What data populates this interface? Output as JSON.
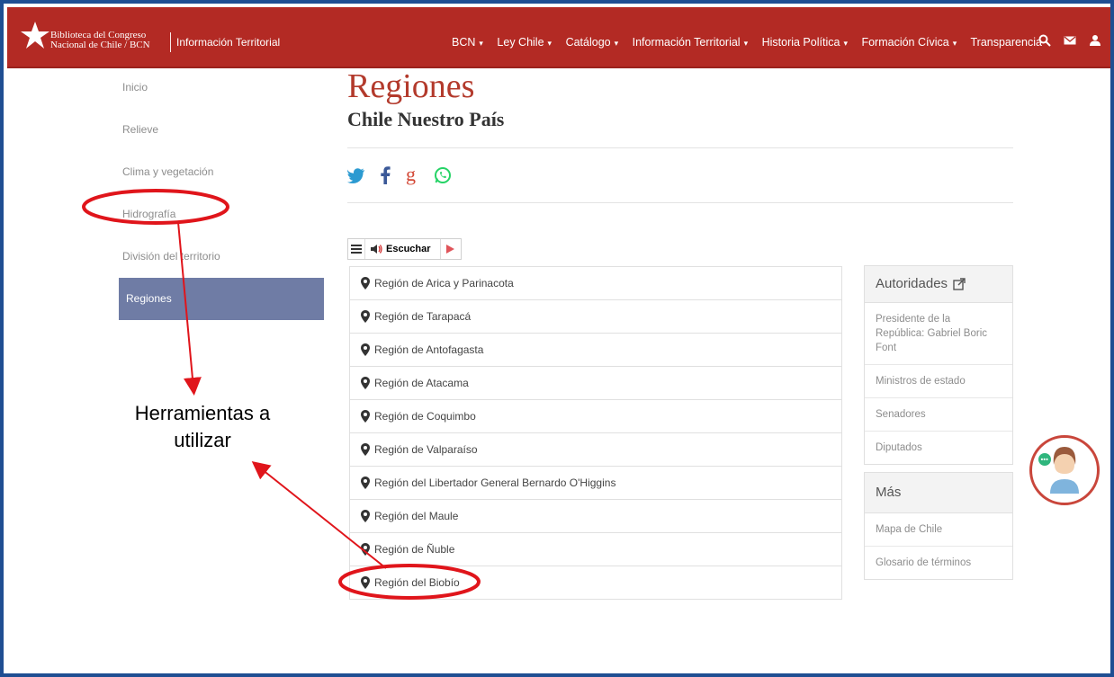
{
  "header": {
    "brand_line1": "Biblioteca del Congreso",
    "brand_line2": "Nacional de Chile / BCN",
    "section": "Información Territorial",
    "nav": [
      "BCN",
      "Ley Chile",
      "Catálogo",
      "Información Territorial",
      "Historia Política",
      "Formación Cívica",
      "Transparencia"
    ],
    "icons": [
      "search-icon",
      "mail-icon",
      "user-icon"
    ]
  },
  "sidebar": {
    "items": [
      {
        "label": "Inicio"
      },
      {
        "label": "Relieve"
      },
      {
        "label": "Clima y vegetación"
      },
      {
        "label": "Hidrografía"
      },
      {
        "label": "División del territorio"
      },
      {
        "label": "Regiones",
        "active": true
      }
    ]
  },
  "main": {
    "title": "Regiones",
    "subtitle": "Chile Nuestro País",
    "social_icons": [
      "twitter-icon",
      "facebook-icon",
      "google-plus-icon",
      "whatsapp-icon"
    ],
    "player_label": "Escuchar",
    "regions": [
      "Región de Arica y Parinacota",
      "Región de Tarapacá",
      "Región de Antofagasta",
      "Región de Atacama",
      "Región de Coquimbo",
      "Región de Valparaíso",
      "Región del Libertador General Bernardo O'Higgins",
      "Región del Maule",
      "Región de Ñuble",
      "Región del Biobío"
    ]
  },
  "widgets": {
    "autoridades": {
      "title": "Autoridades",
      "items": [
        "Presidente de la República: Gabriel Boric Font",
        "Ministros de estado",
        "Senadores",
        "Diputados"
      ]
    },
    "mas": {
      "title": "Más",
      "items": [
        "Mapa de Chile",
        "Glosario de términos"
      ]
    }
  },
  "annotation": {
    "text": "Herramientas a utilizar"
  },
  "colors": {
    "header_red": "#b32a24",
    "title_red": "#b33a2c",
    "sidebar_active": "#6f7ca5",
    "annotation_red": "#e0151b",
    "frame_blue": "#1f4e92"
  }
}
